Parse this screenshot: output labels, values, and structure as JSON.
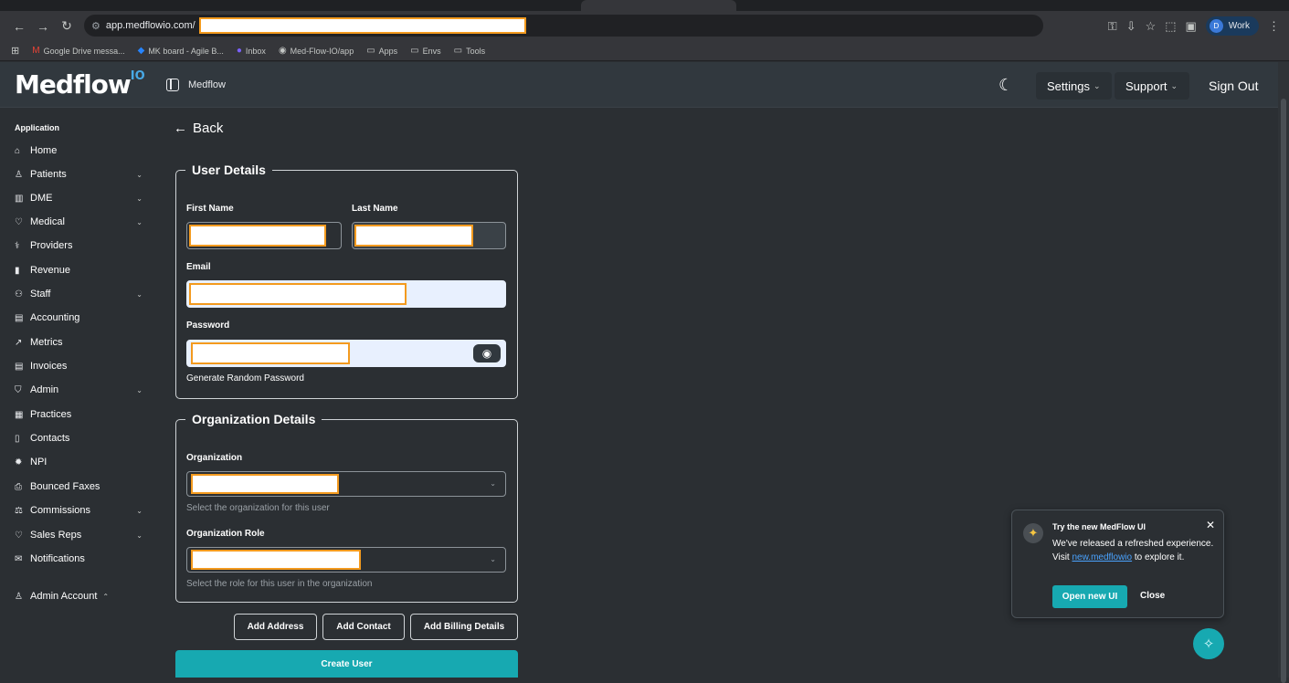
{
  "browser": {
    "url": "app.medflowio.com/",
    "bookmarks": [
      {
        "label": "Google Drive messa...",
        "icon": "gmail-icon"
      },
      {
        "label": "MK board - Agile B...",
        "icon": "jira-icon"
      },
      {
        "label": "Inbox",
        "icon": "inbox-icon"
      },
      {
        "label": "Med-Flow-IO/app",
        "icon": "github-icon"
      },
      {
        "label": "Apps",
        "icon": "folder-icon"
      },
      {
        "label": "Envs",
        "icon": "folder-icon"
      },
      {
        "label": "Tools",
        "icon": "folder-icon"
      }
    ],
    "profile_initial": "D",
    "profile_label": "Work"
  },
  "header": {
    "logo": "Medflow",
    "logo_suffix": "IO",
    "brand_label": "Medflow",
    "settings_label": "Settings",
    "support_label": "Support",
    "signout_label": "Sign Out"
  },
  "sidebar": {
    "section_label": "Application",
    "items": [
      {
        "label": "Home",
        "icon": "⌂",
        "chevron": false
      },
      {
        "label": "Patients",
        "icon": "♙",
        "chevron": true
      },
      {
        "label": "DME",
        "icon": "▥",
        "chevron": true
      },
      {
        "label": "Medical",
        "icon": "♡",
        "chevron": true
      },
      {
        "label": "Providers",
        "icon": "⚕",
        "chevron": false
      },
      {
        "label": "Revenue",
        "icon": "▮",
        "chevron": false
      },
      {
        "label": "Staff",
        "icon": "⚇",
        "chevron": true
      },
      {
        "label": "Accounting",
        "icon": "▤",
        "chevron": false
      },
      {
        "label": "Metrics",
        "icon": "↗",
        "chevron": false
      },
      {
        "label": "Invoices",
        "icon": "▤",
        "chevron": false
      },
      {
        "label": "Admin",
        "icon": "⛉",
        "chevron": true
      },
      {
        "label": "Practices",
        "icon": "▦",
        "chevron": false
      },
      {
        "label": "Contacts",
        "icon": "▯",
        "chevron": false
      },
      {
        "label": "NPI",
        "icon": "✹",
        "chevron": false
      },
      {
        "label": "Bounced Faxes",
        "icon": "⎙",
        "chevron": false
      },
      {
        "label": "Commissions",
        "icon": "⚖",
        "chevron": true
      },
      {
        "label": "Sales Reps",
        "icon": "♡",
        "chevron": true
      },
      {
        "label": "Notifications",
        "icon": "✉",
        "chevron": false
      }
    ],
    "account_label": "Admin Account"
  },
  "main": {
    "back_label": "Back",
    "user_details": {
      "legend": "User Details",
      "first_name_label": "First Name",
      "last_name_label": "Last Name",
      "email_label": "Email",
      "password_label": "Password",
      "generate_password_label": "Generate Random Password"
    },
    "org_details": {
      "legend": "Organization Details",
      "organization_label": "Organization",
      "organization_helper": "Select the organization for this user",
      "role_label": "Organization Role",
      "role_helper": "Select the role for this user in the organization"
    },
    "buttons": {
      "add_address": "Add Address",
      "add_contact": "Add Contact",
      "add_billing": "Add Billing Details",
      "create_user": "Create User"
    }
  },
  "toast": {
    "title": "Try the new MedFlow UI",
    "body_prefix": "We've released a refreshed experience. Visit",
    "link_text": "new.medflowio",
    "body_suffix": "to explore it.",
    "open_label": "Open new UI",
    "close_label": "Close"
  },
  "colors": {
    "accent": "#17a9b1",
    "header_bg": "#31383e",
    "page_bg": "#2b2f33",
    "redaction_border": "#f39a1e"
  }
}
